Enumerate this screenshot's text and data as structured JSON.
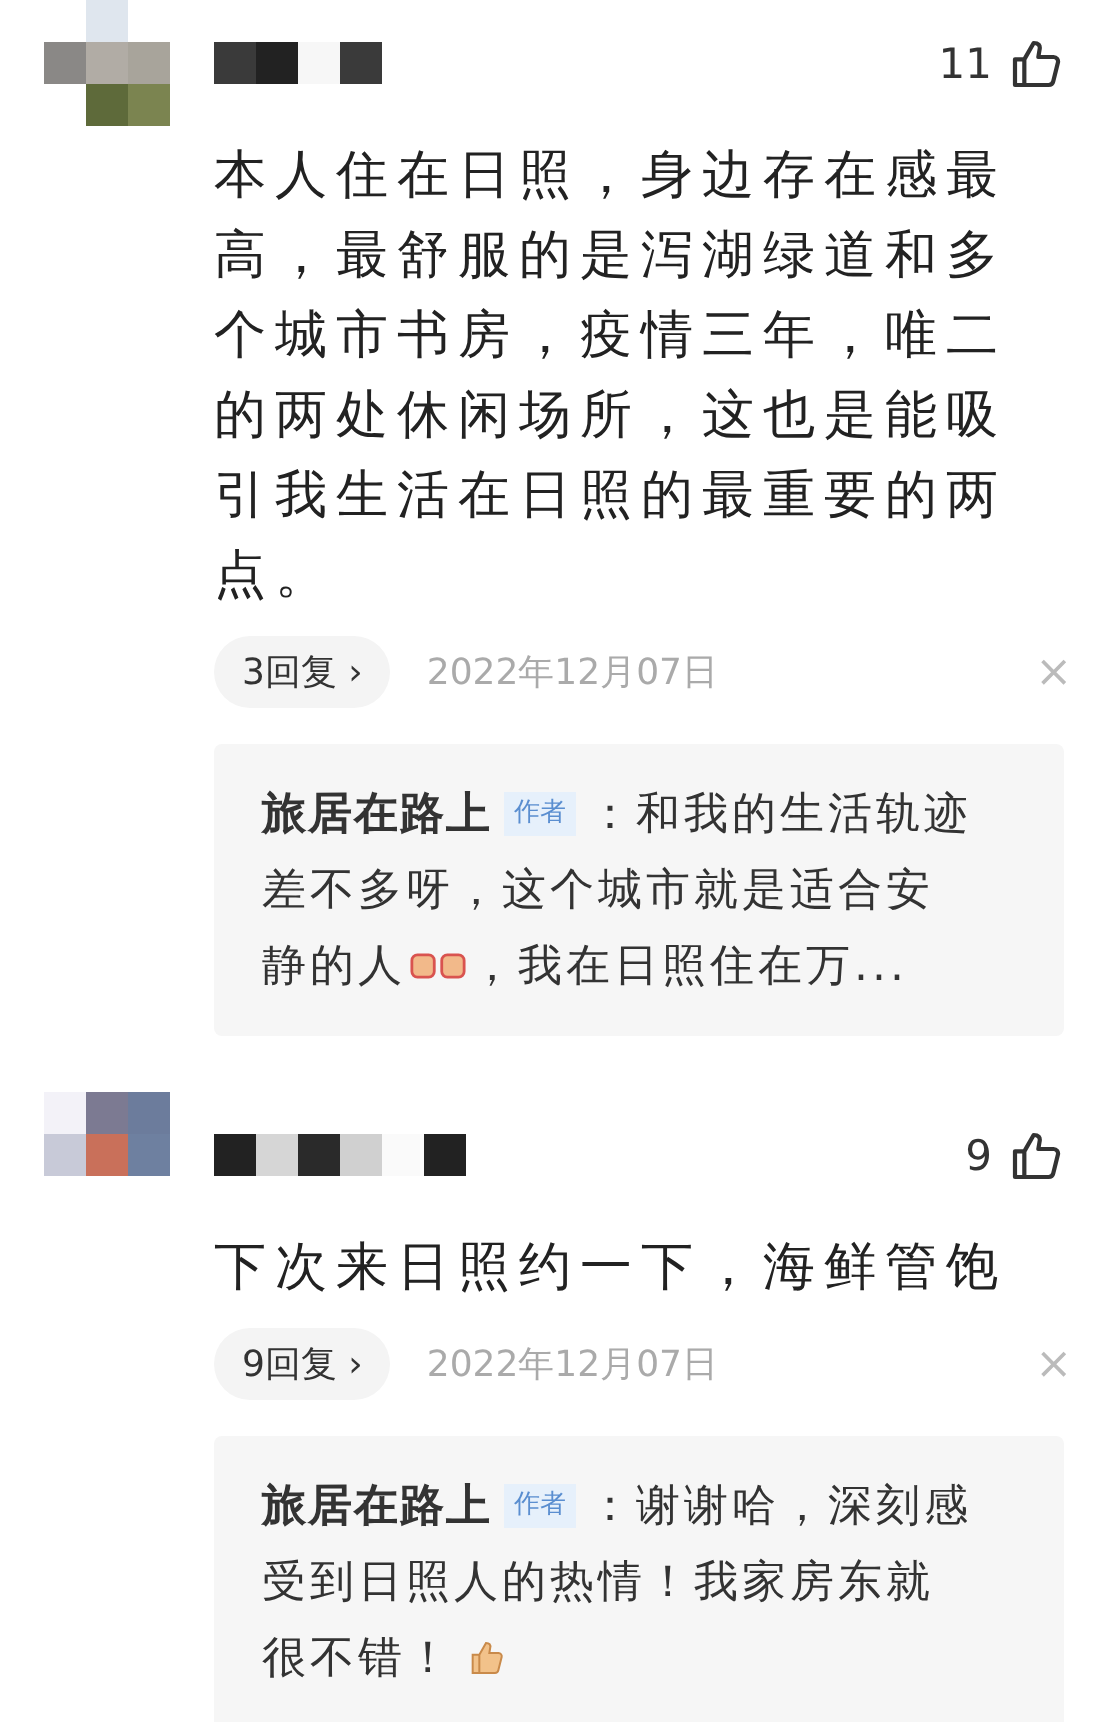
{
  "comments": [
    {
      "likes": "11",
      "body": "本人住在日照，身边存在感最高，最舒服的是泻湖绿道和多个城市书房，疫情三年，唯二的两处休闲场所，这也是能吸引我生活在日照的最重要的两点。",
      "replies": "3回复",
      "chevron": "›",
      "date": "2022年12月07日",
      "close": "×",
      "reply": {
        "lines": [
          [
            {
              "kind": "author",
              "text": "旅居在路上"
            },
            {
              "kind": "badge",
              "text": "作者"
            },
            {
              "kind": "text",
              "text": "：和我的生活轨迹"
            }
          ],
          [
            {
              "kind": "text",
              "text": "差不多呀，这个城市就是适合安"
            }
          ],
          [
            {
              "kind": "text",
              "text": "静的人"
            },
            {
              "kind": "fist-emoji"
            },
            {
              "kind": "text",
              "text": "，我在日照住在万..."
            }
          ]
        ]
      }
    },
    {
      "likes": "9",
      "body": "下次来日照约一下，海鲜管饱",
      "replies": "9回复",
      "chevron": "›",
      "date": "2022年12月07日",
      "close": "×",
      "reply": {
        "lines": [
          [
            {
              "kind": "author",
              "text": "旅居在路上"
            },
            {
              "kind": "badge",
              "text": "作者"
            },
            {
              "kind": "text",
              "text": "：谢谢哈，深刻感"
            }
          ],
          [
            {
              "kind": "text",
              "text": "受到日照人的热情！我家房东就"
            }
          ],
          [
            {
              "kind": "text",
              "text": "很不错！"
            },
            {
              "kind": "thumb-emoji"
            }
          ]
        ]
      }
    }
  ]
}
